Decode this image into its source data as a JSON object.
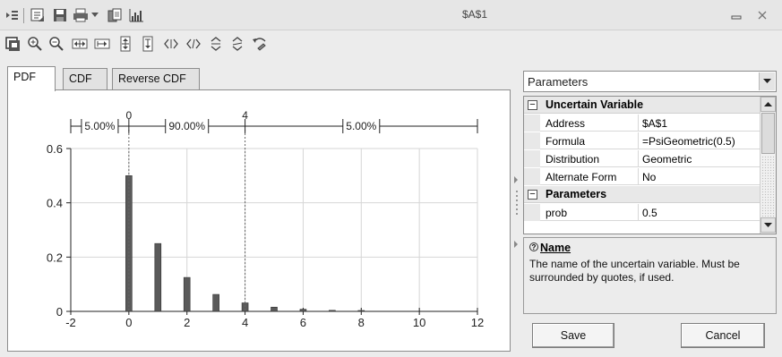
{
  "window": {
    "title": "$A$1",
    "minimize_icon": "minimize-icon",
    "close_icon": "close-icon"
  },
  "quick_access": [
    "menu-icon",
    "report-icon",
    "save-icon",
    "print-icon",
    "dropdown-arrow-icon",
    "copy-icon",
    "chart-options-icon"
  ],
  "toolbar": [
    "chart-icon",
    "zoom-in-icon",
    "zoom-out-icon",
    "fit-width-icon",
    "fit-width-alt-icon",
    "fit-height-icon",
    "fit-height-alt-icon",
    "move-left-icon",
    "move-right-icon",
    "move-up-icon",
    "rotate-icon",
    "undo-icon"
  ],
  "tabs": [
    {
      "label": "PDF",
      "active": true
    },
    {
      "label": "CDF",
      "active": false
    },
    {
      "label": "Reverse CDF",
      "active": false
    }
  ],
  "chart_data": {
    "type": "bar",
    "distribution": "Geometric",
    "x": [
      0,
      1,
      2,
      3,
      4,
      5,
      6,
      7,
      8
    ],
    "values": [
      0.5,
      0.25,
      0.125,
      0.0625,
      0.03125,
      0.015625,
      0.0078125,
      0.00390625,
      0.00195
    ],
    "xlim": [
      -2,
      12
    ],
    "ylim": [
      0,
      0.6
    ],
    "xticks": [
      "-2",
      "0",
      "2",
      "4",
      "6",
      "8",
      "10",
      "12"
    ],
    "yticks": [
      "0",
      "0.2",
      "0.4",
      "0.6"
    ],
    "grid": true,
    "markers": [
      {
        "x": 0,
        "label": "0"
      },
      {
        "x": 4,
        "label": "4"
      }
    ],
    "percentiles": [
      {
        "label": "5.00%"
      },
      {
        "label": "90.00%"
      },
      {
        "label": "5.00%"
      }
    ],
    "bar_color": "#5a5a5a"
  },
  "properties": {
    "dropdown_value": "Parameters",
    "categories": [
      {
        "label": "Uncertain Variable",
        "rows": [
          {
            "name": "Address",
            "value": "$A$1"
          },
          {
            "name": "Formula",
            "value": "=PsiGeometric(0.5)"
          },
          {
            "name": "Distribution",
            "value": "Geometric"
          },
          {
            "name": "Alternate Form",
            "value": "No"
          }
        ]
      },
      {
        "label": "Parameters",
        "rows": [
          {
            "name": "prob",
            "value": "0.5"
          }
        ]
      }
    ]
  },
  "help": {
    "title": "Name",
    "text": "The name of the uncertain variable. Must be surrounded by quotes, if used."
  },
  "buttons": {
    "save": "Save",
    "cancel": "Cancel"
  }
}
